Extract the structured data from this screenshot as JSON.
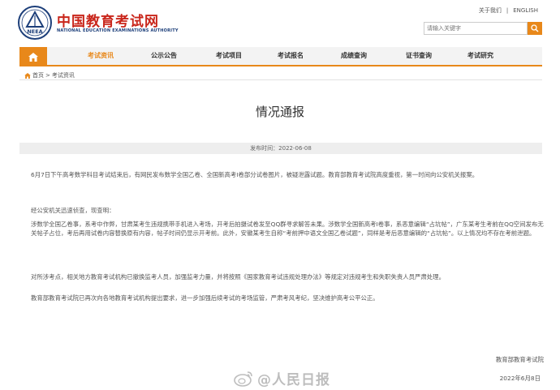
{
  "header": {
    "site_name": "中国教育考试网",
    "site_name_en": "NATIONAL EDUCATION EXAMINATIONS AUTHORITY",
    "logo_text": "NEEA",
    "top_links": [
      "关于我们",
      "ENGLISH"
    ],
    "search_placeholder": "请输入关键字"
  },
  "nav": {
    "items": [
      {
        "label": "考试资讯",
        "active": true
      },
      {
        "label": "公示公告",
        "active": false
      },
      {
        "label": "考试项目",
        "active": false
      },
      {
        "label": "考试报名",
        "active": false
      },
      {
        "label": "成绩查询",
        "active": false
      },
      {
        "label": "证书查询",
        "active": false
      },
      {
        "label": "考试研究",
        "active": false
      }
    ]
  },
  "breadcrumb": {
    "home": "首页",
    "separator": ">",
    "current": "考试资讯"
  },
  "article": {
    "title": "情况通报",
    "date_label": "发布时间：2022-06-08",
    "paragraphs": [
      "6月7日下午高考数学科目考试结束后，有网民发布数学全国乙卷、全国新高考I卷部分试卷图片，被疑泄露试题。教育部教育考试院高度重视，第一时间向公安机关报案。",
      "经公安机关迅速侦查，现查明：",
      "涉数学全国乙卷事，系考中作弊，甘肃某考生违规携带手机进入考场，开考后拍摄试卷发至QQ群寻求解答未果。涉数学全国新高考I卷事，系恶意编辑“占坑帖”，广东某考生考前在QQ空间发布无关帖子占位，考后再用试卷内容替换原有内容，帖子时间仍显示开考前。此外，安徽某考生自称“考前押中语文全国乙卷试题”，同样是考后恶意编辑的“占坑帖”。以上情况均不存在考前泄题。",
      "对所涉考点，相关地方教育考试机构已撤换监考人员，加强监考力量，并将按照《国家教育考试违规处理办法》等规定对违规考生和失职失责人员严肃处理。",
      "教育部教育考试院已再次向各地教育考试机构提出要求，进一步加强后续考试的考场监管，严肃考风考纪，坚决维护高考公平公正。"
    ],
    "signature_org": "教育部教育考试院",
    "signature_date": "2022年6月8日"
  },
  "watermark": {
    "text": "@人民日报"
  },
  "colors": {
    "brand_red": "#c9261b",
    "accent_orange": "#e8881a",
    "nav_bg": "#f3f3f3"
  }
}
